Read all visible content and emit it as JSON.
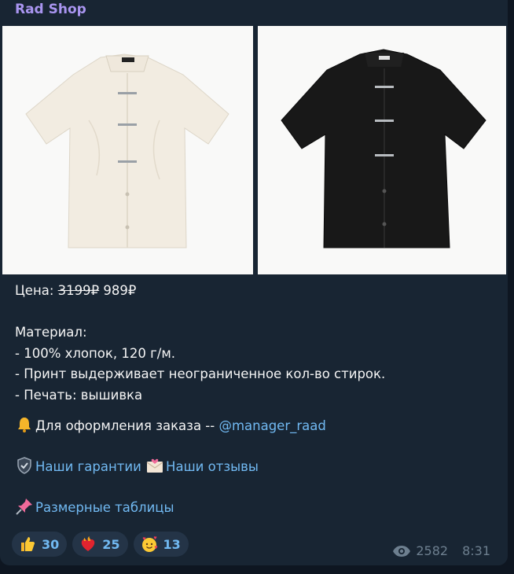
{
  "channel": {
    "name": "Rad Shop"
  },
  "post": {
    "price_label": "Цена:",
    "old_price": "3199₽",
    "new_price": "989₽",
    "material_title": "Материал:",
    "material_lines": [
      "- 100% хлопок, 120 г/м.",
      "- Принт выдерживает неограниченное кол-во стирок.",
      "- Печать: вышивка"
    ],
    "order_text": "Для оформления заказа -- ",
    "order_link": "@manager_raad",
    "guarantees_link": "Наши гарантии",
    "reviews_link": "Наши отзывы",
    "sizes_link": "Размерные таблицы",
    "icons": {
      "order": "bell-icon",
      "guarantees": "shield-check-icon",
      "reviews": "love-letter-icon",
      "sizes": "pushpin-icon"
    }
  },
  "photos": [
    {
      "name": "white-shirt-photo",
      "shirt_color": "#f3ede3"
    },
    {
      "name": "black-shirt-photo",
      "shirt_color": "#1a1a1a"
    }
  ],
  "reactions": [
    {
      "icon": "thumbs-up-icon",
      "count": "30"
    },
    {
      "icon": "burning-heart-icon",
      "count": "25"
    },
    {
      "icon": "smiling-face-hearts-icon",
      "count": "13"
    }
  ],
  "meta": {
    "views": "2582",
    "time": "8:31",
    "views_icon": "eye-icon"
  },
  "colors": {
    "accent": "#71b9f2",
    "channel_name": "#a995f0",
    "bubble": "#182533",
    "background": "#0e1621"
  }
}
